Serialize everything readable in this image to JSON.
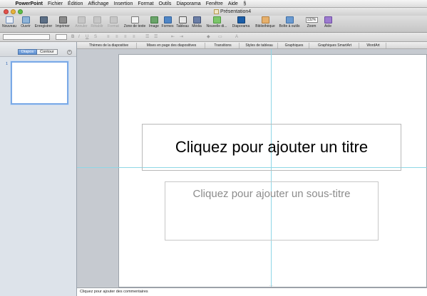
{
  "menubar": {
    "apple": "",
    "app": "PowerPoint",
    "items": [
      "Fichier",
      "Édition",
      "Affichage",
      "Insertion",
      "Format",
      "Outils",
      "Diaporama",
      "Fenêtre",
      "Aide"
    ],
    "script_icon": "§"
  },
  "window": {
    "title": "Présentation4"
  },
  "toolbar": {
    "nouveau": "Nouveau",
    "ouvrir": "Ouvrir",
    "enregistrer": "Enregistrer",
    "imprimer": "Imprimer",
    "annuler": "Annuler",
    "retablir": "Rétablir",
    "reproduire": "Format",
    "zone_texte": "Zone de texte",
    "image": "Image",
    "formes": "Formes",
    "tableau": "Tableau",
    "media": "Média",
    "nouvelle_diapo": "Nouvelle di...",
    "diaporama": "Diaporama",
    "bibliotheque": "Bibliothèque",
    "boite_outils": "Boîte à outils",
    "zoom_value": "132%",
    "zoom_label": "Zoom",
    "aide": "Aide"
  },
  "ribbon_tabs": [
    "Thèmes de la diapositive",
    "Mises en page des diapositives",
    "Transitions",
    "Styles de tableau",
    "Graphiques",
    "Graphiques SmartArt",
    "WordArt"
  ],
  "left_pane": {
    "tabs": [
      "Diapos",
      "Contour"
    ],
    "active_tab": "Diapos",
    "slide_number": "1"
  },
  "slide": {
    "title_placeholder": "Cliquez pour ajouter un titre",
    "subtitle_placeholder": "Cliquez pour ajouter un sous-titre"
  },
  "notes": {
    "placeholder": "Cliquez pour ajouter des commentaires"
  },
  "colors": {
    "accent": "#5c8ed0",
    "guide": "#8fd7e6"
  }
}
